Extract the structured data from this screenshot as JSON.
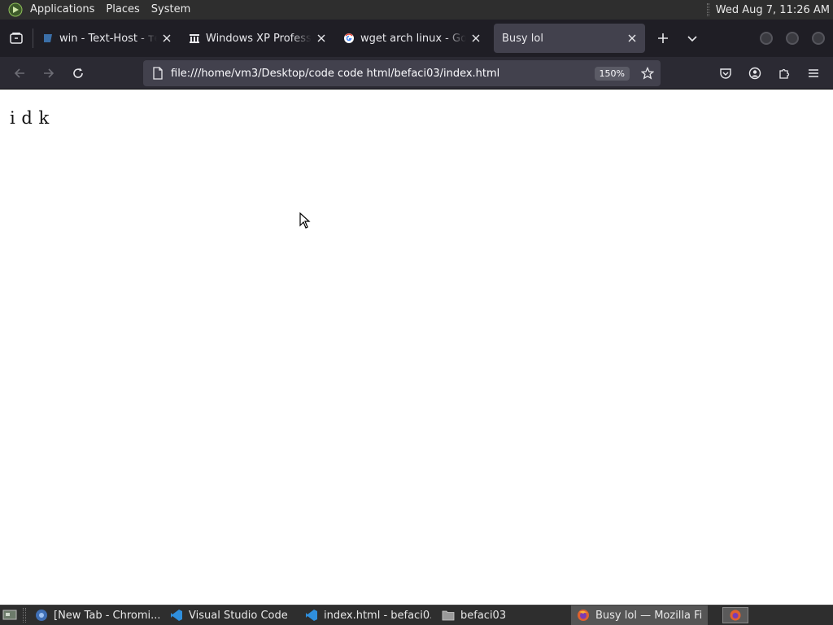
{
  "top_panel": {
    "menus": [
      "Applications",
      "Places",
      "System"
    ],
    "clock": "Wed Aug  7, 11:26 AM"
  },
  "browser": {
    "tabs": [
      {
        "title": "win - Text-Host - текст",
        "favicon": "texthost-icon",
        "active": false
      },
      {
        "title": "Windows XP Professional",
        "favicon": "archive-icon",
        "active": false
      },
      {
        "title": "wget arch linux - Google",
        "favicon": "google-icon",
        "active": false
      },
      {
        "title": "Busy lol",
        "favicon": "",
        "active": true
      }
    ],
    "url": "file:///home/vm3/Desktop/code code html/befaci03/index.html",
    "zoom": "150%"
  },
  "page": {
    "body_text": "i d k"
  },
  "taskbar": {
    "tasks": [
      {
        "label": "[New Tab - Chromi...",
        "icon": "chromium-icon",
        "active": false
      },
      {
        "label": "Visual Studio Code",
        "icon": "vscode-icon",
        "active": false
      },
      {
        "label": "index.html - befaci0...",
        "icon": "vscode-icon",
        "active": false
      },
      {
        "label": "befaci03",
        "icon": "folder-icon",
        "active": false
      },
      {
        "label": "Busy lol — Mozilla Fi...",
        "icon": "firefox-icon",
        "active": true
      }
    ]
  },
  "colors": {
    "panel_bg": "#2e2e2e",
    "tabstrip_bg": "#1f1e25",
    "toolbar_bg": "#2b2a33",
    "urlbar_bg": "#42414d"
  }
}
